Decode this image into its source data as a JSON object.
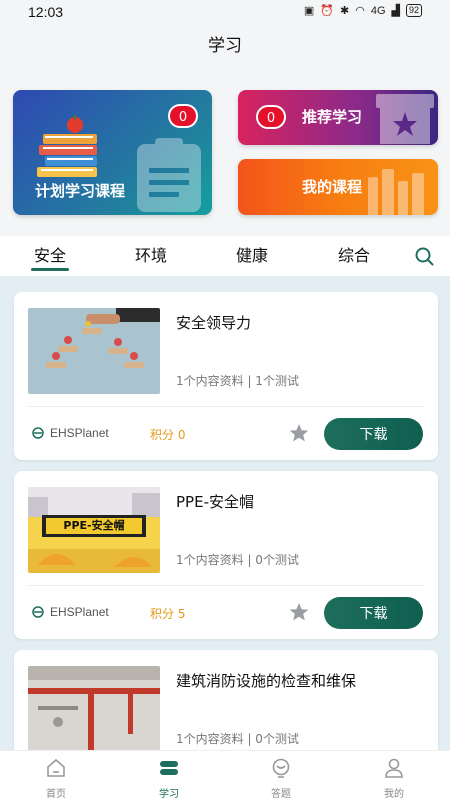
{
  "status_bar": {
    "time": "12:03",
    "signal_text": "4G",
    "battery": "92"
  },
  "header": {
    "title": "学习"
  },
  "hero": {
    "plan": {
      "label": "计划学习课程",
      "badge": "0"
    },
    "recommend": {
      "label": "推荐学习",
      "badge": "0"
    },
    "my_courses": {
      "label": "我的课程"
    }
  },
  "tabs": [
    {
      "label": "安全",
      "active": true
    },
    {
      "label": "环境",
      "active": false
    },
    {
      "label": "健康",
      "active": false
    },
    {
      "label": "综合",
      "active": false
    }
  ],
  "courses": [
    {
      "title": "安全领导力",
      "meta": "1个内容资料 | 1个测试",
      "provider": "EHSPlanet",
      "points": "积分 0",
      "download": "下载"
    },
    {
      "title": "PPE-安全帽",
      "meta": "1个内容资料 | 0个测试",
      "provider": "EHSPlanet",
      "points": "积分 5",
      "download": "下载",
      "thumb_text": "PPE-安全帽"
    },
    {
      "title": "建筑消防设施的检查和维保",
      "meta": "1个内容资料 | 0个测试"
    }
  ],
  "bottom_nav": [
    {
      "label": "首页",
      "icon": "home-icon",
      "active": false
    },
    {
      "label": "学习",
      "icon": "study-icon",
      "active": true
    },
    {
      "label": "答题",
      "icon": "quiz-icon",
      "active": false
    },
    {
      "label": "我的",
      "icon": "profile-icon",
      "active": false
    }
  ],
  "colors": {
    "accent": "#1e6e5c",
    "points": "#e39a1a",
    "badge": "#e5112b"
  }
}
